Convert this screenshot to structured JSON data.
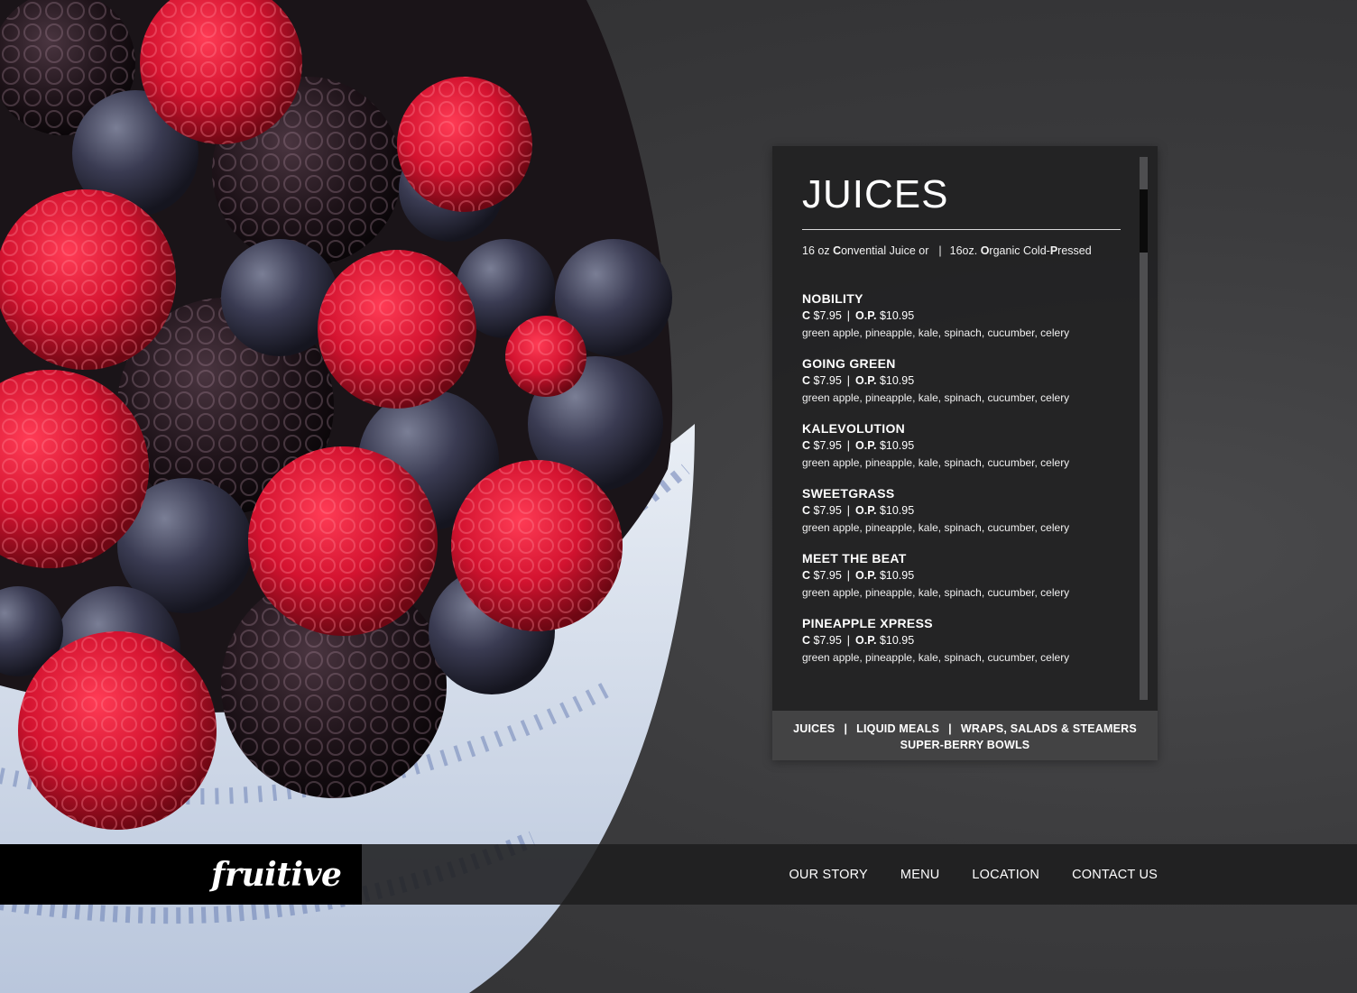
{
  "menu": {
    "title": "JUICES",
    "subtitle": {
      "left_prefix": "16 oz ",
      "left_bold": "C",
      "left_suffix": "onvential Juice or",
      "separator": "|",
      "right_prefix": "16oz. ",
      "right_bold1": "O",
      "right_mid": "rganic Cold-",
      "right_bold2": "P",
      "right_suffix": "ressed"
    },
    "items": [
      {
        "name": "NOBILITY",
        "c_label": "C",
        "c_price": "$7.95",
        "op_label": "O.P.",
        "op_price": "$10.95",
        "description": "green apple, pineapple, kale, spinach, cucumber, celery"
      },
      {
        "name": "GOING GREEN",
        "c_label": "C",
        "c_price": "$7.95",
        "op_label": "O.P.",
        "op_price": "$10.95",
        "description": "green apple, pineapple, kale, spinach, cucumber, celery"
      },
      {
        "name": "KALEVOLUTION",
        "c_label": "C",
        "c_price": "$7.95",
        "op_label": "O.P.",
        "op_price": "$10.95",
        "description": "green apple, pineapple, kale, spinach, cucumber, celery"
      },
      {
        "name": "SWEETGRASS",
        "c_label": "C",
        "c_price": "$7.95",
        "op_label": "O.P.",
        "op_price": "$10.95",
        "description": "green apple, pineapple, kale, spinach, cucumber, celery"
      },
      {
        "name": "MEET THE BEAT",
        "c_label": "C",
        "c_price": "$7.95",
        "op_label": "O.P.",
        "op_price": "$10.95",
        "description": "green apple, pineapple, kale, spinach, cucumber, celery"
      },
      {
        "name": "PINEAPPLE XPRESS",
        "c_label": "C",
        "c_price": "$7.95",
        "op_label": "O.P.",
        "op_price": "$10.95",
        "description": "green apple, pineapple, kale, spinach, cucumber, celery"
      }
    ],
    "price_separator": "|",
    "tabs": {
      "juices": "JUICES",
      "liquid_meals": "LIQUID MEALS",
      "wraps": "WRAPS, SALADS & STEAMERS",
      "bowls": "SUPER-BERRY BOWLS",
      "separator": "|"
    }
  },
  "footer": {
    "logo_text": "fruitive",
    "nav": [
      "OUR STORY",
      "MENU",
      "LOCATION",
      "CONTACT US"
    ]
  }
}
